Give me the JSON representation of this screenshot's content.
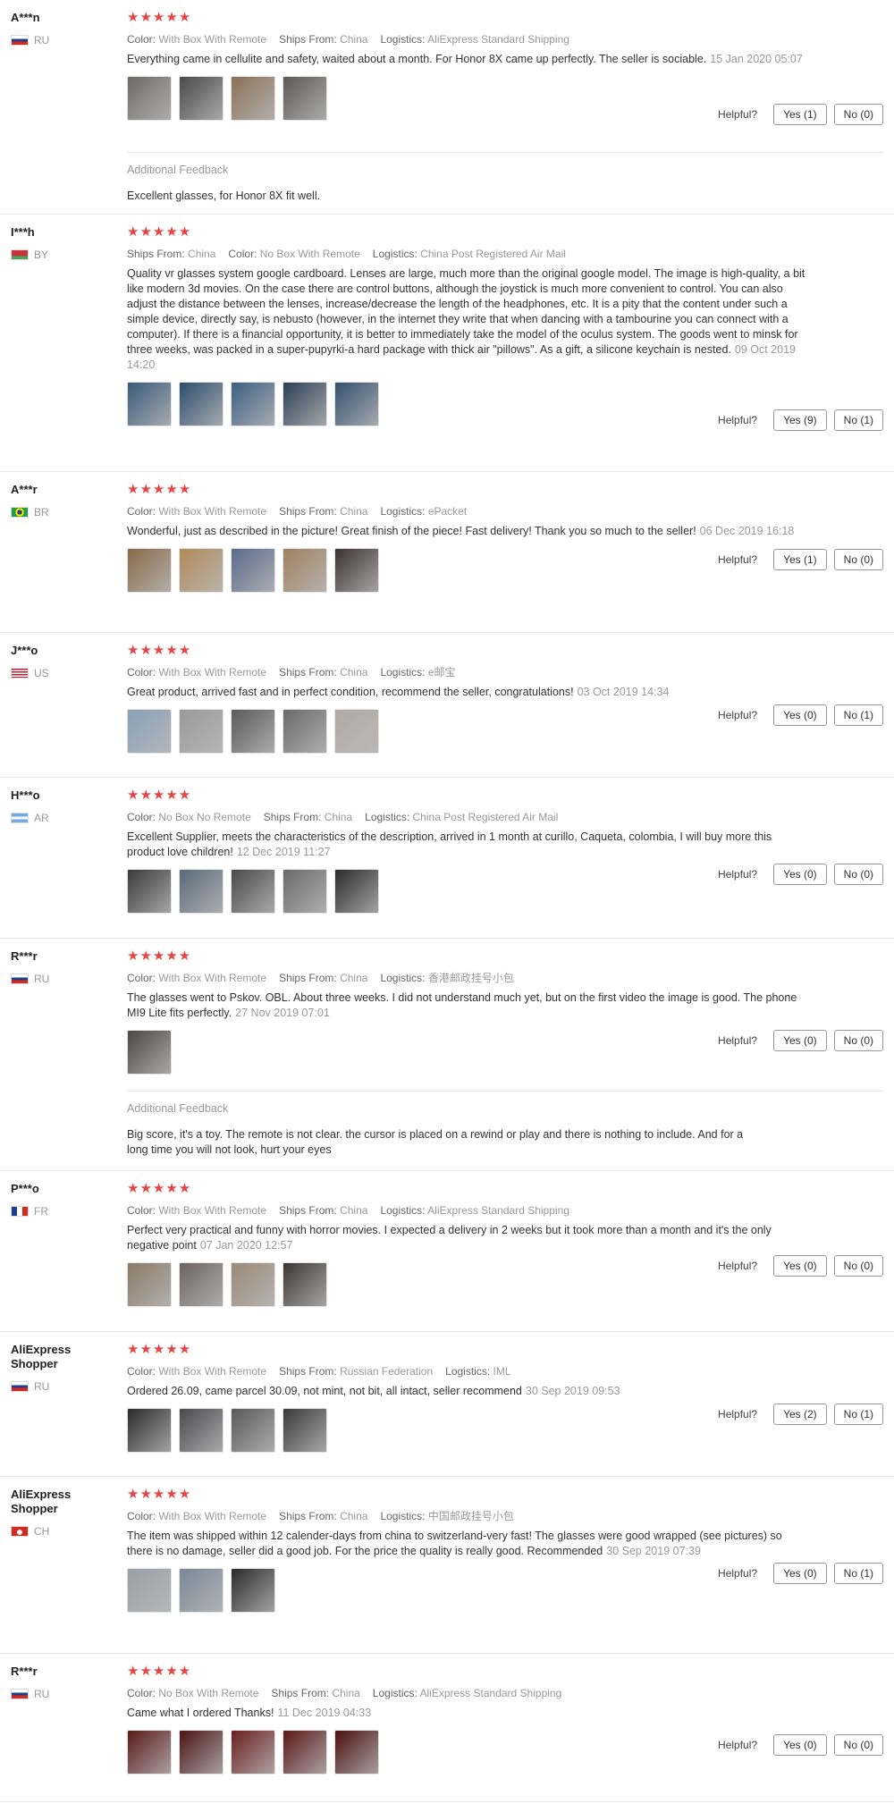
{
  "helpful_label": "Helpful?",
  "additional_title": "Additional Feedback",
  "stars": "★★★★★",
  "reviews": [
    {
      "user": "A***n",
      "country": "RU",
      "meta": [
        [
          "Color:",
          "With Box With Remote"
        ],
        [
          "Ships From:",
          "China"
        ],
        [
          "Logistics:",
          "AliExpress Standard Shipping"
        ]
      ],
      "text": "Everything came in cellulite and safety, waited about a month. For Honor 8X came up perfectly. The seller is sociable.",
      "date": "15 Jan 2020 05:07",
      "photos": [
        "#6d6a66",
        "#4a4a4a",
        "#8a7058",
        "#5c5a58"
      ],
      "yes": "Yes (1)",
      "no": "No (0)",
      "additional": "Excellent glasses, for Honor 8X fit well."
    },
    {
      "user": "I***h",
      "country": "BY",
      "meta": [
        [
          "Ships From:",
          "China"
        ],
        [
          "Color:",
          "No Box With Remote"
        ],
        [
          "Logistics:",
          "China Post Registered Air Mail"
        ]
      ],
      "text": "Quality vr glasses system google cardboard. Lenses are large, much more than the original google model. The image is high-quality, a bit like modern 3d movies. On the case there are control buttons, although the joystick is much more convenient to control. You can also adjust the distance between the lenses, increase/decrease the length of the headphones, etc. It is a pity that the content under such a simple device, directly say, is nebusto (however, in the internet they write that when dancing with a tambourine you can connect with a computer). If there is a financial opportunity, it is better to immediately take the model of the oculus system. The goods went to minsk for three weeks, was packed in a super-pupyrki-a hard package with thick air \"pillows\". As a gift, a silicone keychain is nested.",
      "date": "09 Oct 2019 14:20",
      "photos": [
        "#3a5a7a",
        "#2f4e6c",
        "#3d5f80",
        "#2b3f55",
        "#34506e"
      ],
      "yes": "Yes (9)",
      "no": "No (1)",
      "additional": ""
    },
    {
      "user": "A***r",
      "country": "BR",
      "meta": [
        [
          "Color:",
          "With Box With Remote"
        ],
        [
          "Ships From:",
          "China"
        ],
        [
          "Logistics:",
          "ePacket"
        ]
      ],
      "text": "Wonderful, just as described in the picture! Great finish of the piece! Fast delivery! Thank you so much to the seller!",
      "date": "06 Dec 2019 16:18",
      "photos": [
        "#8a6a4a",
        "#b08a5a",
        "#5a6a8a",
        "#a08060",
        "#3a3230"
      ],
      "yes": "Yes (1)",
      "no": "No (0)",
      "additional": ""
    },
    {
      "user": "J***o",
      "country": "US",
      "meta": [
        [
          "Color:",
          "With Box With Remote"
        ],
        [
          "Ships From:",
          "China"
        ],
        [
          "Logistics:",
          "e邮宝"
        ]
      ],
      "text": "Great product, arrived fast and in perfect condition, recommend the seller, congratulations!",
      "date": "03 Oct 2019 14:34",
      "photos": [
        "#8aa0b8",
        "#9a9a9a",
        "#5a5a5a",
        "#6a6a6a",
        "#b0aaa4"
      ],
      "yes": "Yes (0)",
      "no": "No (1)",
      "additional": ""
    },
    {
      "user": "H***o",
      "country": "AR",
      "meta": [
        [
          "Color:",
          "No Box No Remote"
        ],
        [
          "Ships From:",
          "China"
        ],
        [
          "Logistics:",
          "China Post Registered Air Mail"
        ]
      ],
      "text": "Excellent Supplier, meets the characteristics of the description, arrived in 1 month at curillo, Caqueta, colombia, I will buy more this product love children!",
      "date": "12 Dec 2019 11:27",
      "photos": [
        "#3a3a3a",
        "#5a6a7a",
        "#4a4a4a",
        "#6a6a6a",
        "#2a2a2a"
      ],
      "yes": "Yes (0)",
      "no": "No (0)",
      "additional": ""
    },
    {
      "user": "R***r",
      "country": "RU",
      "meta": [
        [
          "Color:",
          "With Box With Remote"
        ],
        [
          "Ships From:",
          "China"
        ],
        [
          "Logistics:",
          "香港邮政挂号小包"
        ]
      ],
      "text": "The glasses went to Pskov. OBL. About three weeks. I did not understand much yet, but on the first video the image is good. The phone MI9 Lite fits perfectly.",
      "date": "27 Nov 2019 07:01",
      "photos": [
        "#4a4844"
      ],
      "yes": "Yes (0)",
      "no": "No (0)",
      "additional": "Big score, it's a toy. The remote is not clear. the cursor is placed on a rewind or play and there is nothing to include. And for a long time you will not look, hurt your eyes"
    },
    {
      "user": "P***o",
      "country": "FR",
      "meta": [
        [
          "Color:",
          "With Box With Remote"
        ],
        [
          "Ships From:",
          "China"
        ],
        [
          "Logistics:",
          "AliExpress Standard Shipping"
        ]
      ],
      "text": "Perfect very practical and funny with horror movies. I expected a delivery in 2 weeks but it took more than a month and it's the only negative point",
      "date": "07 Jan 2020 12:57",
      "photos": [
        "#8a7a68",
        "#6a6460",
        "#9a8a78",
        "#3a3634"
      ],
      "yes": "Yes (0)",
      "no": "No (0)",
      "additional": ""
    },
    {
      "user": "AliExpress Shopper",
      "country": "RU",
      "meta": [
        [
          "Color:",
          "With Box With Remote"
        ],
        [
          "Ships From:",
          "Russian Federation"
        ],
        [
          "Logistics:",
          "IML"
        ]
      ],
      "text": "Ordered 26.09, came parcel 30.09, not mint, not bit, all intact, seller recommend",
      "date": "30 Sep 2019 09:53",
      "photos": [
        "#2a2a2a",
        "#4a4a4e",
        "#5a5a5a",
        "#3a3a3a"
      ],
      "yes": "Yes (2)",
      "no": "No (1)",
      "additional": ""
    },
    {
      "user": "AliExpress Shopper",
      "country": "CH",
      "meta": [
        [
          "Color:",
          "With Box With Remote"
        ],
        [
          "Ships From:",
          "China"
        ],
        [
          "Logistics:",
          "中国邮政挂号小包"
        ]
      ],
      "text": "The item was shipped within 12 calender-days from china to switzerland-very fast! The glasses were good wrapped (see pictures) so there is no damage, seller did a good job. For the price the quality is really good. Recommended",
      "date": "30 Sep 2019 07:39",
      "photos": [
        "#9aa0a8",
        "#7a8898",
        "#2a2a2a"
      ],
      "yes": "Yes (0)",
      "no": "No (1)",
      "additional": ""
    },
    {
      "user": "R***r",
      "country": "RU",
      "meta": [
        [
          "Color:",
          "No Box With Remote"
        ],
        [
          "Ships From:",
          "China"
        ],
        [
          "Logistics:",
          "AliExpress Standard Shipping"
        ]
      ],
      "text": "Came what I ordered Thanks!",
      "date": "11 Dec 2019 04:33",
      "photos": [
        "#5a1a1a",
        "#4a1414",
        "#6a2020",
        "#5a1818",
        "#4a1010"
      ],
      "yes": "Yes (0)",
      "no": "No (0)",
      "additional": ""
    }
  ]
}
